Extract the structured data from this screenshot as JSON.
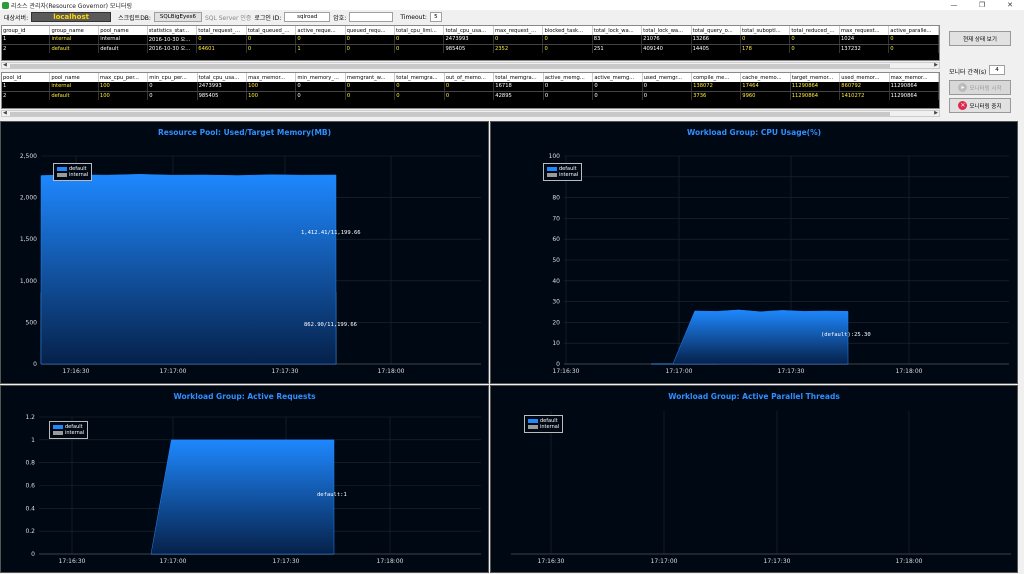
{
  "window": {
    "title": "리소스 관리자(Resource Governor) 모니터링",
    "controls": [
      "—",
      "❐",
      "✕"
    ]
  },
  "toolbar": {
    "server_label": "대상서버:",
    "server_value": "localhost",
    "stat_db_label": "스크립트DB:",
    "stat_db_value": "SQLBigEyes6",
    "auth_label": "SQL Server 인증",
    "login_label": "로그인 ID:",
    "login_value": "sqlroad",
    "pw_label": "암호:",
    "timeout_label": "Timeout:",
    "timeout_value": "5"
  },
  "grid1": {
    "headers": [
      "group_id",
      "group_name",
      "pool_name",
      "statistics_star...",
      "total_request_...",
      "total_queued_...",
      "active_reque...",
      "queued_requ...",
      "total_cpu_limi...",
      "total_cpu_usa...",
      "max_request_...",
      "blocked_task...",
      "total_lock_wa...",
      "total_lock_wa...",
      "total_query_o...",
      "total_suboptl...",
      "total_reduced_...",
      "max_request...",
      "active_paralle..."
    ],
    "rows": [
      [
        "1",
        "internal",
        "internal",
        "2016-10-30 오...",
        "0",
        "0",
        "0",
        "0",
        "0",
        "2473993",
        "0",
        "0",
        "83",
        "21076",
        "13266",
        "0",
        "0",
        "1024",
        "0"
      ],
      [
        "2",
        "default",
        "default",
        "2016-10-30 오...",
        "64601",
        "0",
        "1",
        "0",
        "0",
        "985405",
        "2352",
        "0",
        "251",
        "409140",
        "14405",
        "178",
        "0",
        "137232",
        "0"
      ]
    ],
    "yellow": [
      1,
      4,
      5,
      6,
      7,
      8,
      10,
      11,
      15,
      16,
      18
    ]
  },
  "grid2": {
    "headers": [
      "pool_id",
      "pool_name",
      "max_cpu_per...",
      "min_cpu_per...",
      "total_cpu_usa...",
      "max_memor...",
      "min_memory_...",
      "memgrant_w...",
      "total_memgra...",
      "out_of_memo...",
      "total_memgra...",
      "active_memg...",
      "active_memg...",
      "used_memgr...",
      "compile_me...",
      "cache_memo...",
      "target_memor...",
      "used_memor...",
      "max_memor..."
    ],
    "rows": [
      [
        "1",
        "internal",
        "100",
        "0",
        "2473993",
        "100",
        "0",
        "0",
        "0",
        "0",
        "16718",
        "0",
        "0",
        "0",
        "138072",
        "17464",
        "11290864",
        "860792",
        "11290864"
      ],
      [
        "2",
        "default",
        "100",
        "0",
        "985405",
        "100",
        "0",
        "0",
        "0",
        "0",
        "42895",
        "0",
        "0",
        "0",
        "3736",
        "9960",
        "11290864",
        "1410272",
        "11290864"
      ]
    ],
    "yellow": [
      1,
      2,
      5,
      7,
      8,
      9,
      14,
      15,
      16,
      17
    ]
  },
  "side": {
    "view_label": "현재 상태 보기",
    "interval_label": "모니터 간격(s)",
    "interval_value": "4",
    "start_label": "모니터링 시작",
    "stop_label": "모니터링 중지"
  },
  "charts": {
    "c1": {
      "title": "Resource Pool: Used/Target Memory(MB)",
      "ann1": "1,412.41/11,199.66",
      "ann2": "862.90/11,199.66"
    },
    "c2": {
      "title": "Workload Group: CPU Usage(%)",
      "ann1": "(default):25.30"
    },
    "c3": {
      "title": "Workload Group: Active Requests",
      "ann1": "default:1"
    },
    "c4": {
      "title": "Workload Group: Active Parallel Threads"
    }
  },
  "legend": {
    "default": "default",
    "internal": "internal"
  },
  "colors": {
    "default": "#1e88ff",
    "internal": "#9a9a9a",
    "title": "#2f8fff",
    "grid_yellow": "#ffeb3b"
  },
  "chart_data": [
    {
      "type": "area",
      "title": "Resource Pool: Used/Target Memory(MB)",
      "x": [
        "17:16:30",
        "17:17:00",
        "17:17:30",
        "17:18:00"
      ],
      "ylim": [
        0,
        2500
      ],
      "yticks": [
        "0",
        "500",
        "1,000",
        "1,500",
        "2,000",
        "2,500"
      ],
      "series": [
        {
          "name": "default",
          "values": [
            2265,
            2275,
            2270,
            2280,
            2270,
            2272,
            2265,
            2275,
            2270,
            2272
          ]
        },
        {
          "name": "internal",
          "values": [
            860,
            862,
            863,
            862,
            863,
            862,
            863,
            862,
            863,
            863
          ]
        }
      ]
    },
    {
      "type": "area",
      "title": "Workload Group: CPU Usage(%)",
      "x": [
        "17:16:30",
        "17:17:00",
        "17:17:30",
        "17:18:00"
      ],
      "ylim": [
        0,
        100
      ],
      "yticks": [
        "0",
        "10",
        "20",
        "30",
        "40",
        "50",
        "60",
        "70",
        "80",
        "90",
        "100"
      ],
      "series": [
        {
          "name": "default",
          "values": [
            0,
            0,
            25.5,
            25.3,
            26,
            25.1,
            25.8,
            25.3,
            25.5,
            25.3
          ]
        },
        {
          "name": "internal",
          "values": [
            0,
            0,
            0,
            0,
            1.5,
            0,
            0,
            0,
            0,
            0
          ]
        }
      ]
    },
    {
      "type": "area",
      "title": "Workload Group: Active Requests",
      "x": [
        "17:16:30",
        "17:17:00",
        "17:17:30",
        "17:18:00"
      ],
      "ylim": [
        0,
        1.2
      ],
      "yticks": [
        "0",
        "0.2",
        "0.4",
        "0.6",
        "0.8",
        "1",
        "1.2"
      ],
      "series": [
        {
          "name": "default",
          "values": [
            0,
            1,
            1,
            1,
            1,
            1,
            1,
            1,
            1,
            1
          ]
        },
        {
          "name": "internal",
          "values": [
            0,
            0,
            0,
            0,
            0,
            0,
            0,
            0,
            0,
            0
          ]
        }
      ]
    },
    {
      "type": "area",
      "title": "Workload Group: Active Parallel Threads",
      "x": [
        "17:16:30",
        "17:17:00",
        "17:17:30",
        "17:18:00"
      ],
      "ylim": [
        0,
        1
      ],
      "yticks": [],
      "series": [
        {
          "name": "default",
          "values": []
        },
        {
          "name": "internal",
          "values": []
        }
      ]
    }
  ]
}
